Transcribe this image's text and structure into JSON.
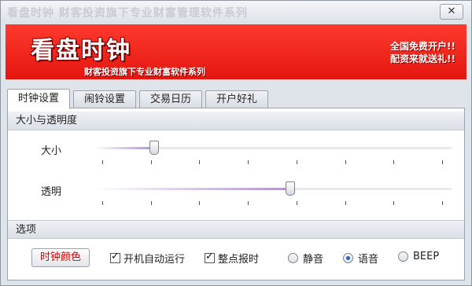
{
  "window": {
    "title": "看盘时钟 财客投资旗下专业财富管理软件系列",
    "close_icon": "close-x"
  },
  "banner": {
    "brand": "看盘时钟",
    "slogan": "财客投资旗下专业财富软件系列",
    "promo_line1": "全国免费开户!!",
    "promo_line2": "配资来就送礼!!"
  },
  "tabs": [
    {
      "label": "时钟设置",
      "active": true
    },
    {
      "label": "闹铃设置",
      "active": false
    },
    {
      "label": "交易日历",
      "active": false
    },
    {
      "label": "开户好礼",
      "active": false
    }
  ],
  "size_group": {
    "title": "大小与透明度",
    "size_label": "大小",
    "size_level": 0.17,
    "opacity_label": "透明",
    "opacity_level": 0.55,
    "tick_count": 8
  },
  "options": {
    "title": "选项",
    "color_button": "时钟颜色",
    "autostart": {
      "label": "开机自动运行",
      "checked": true
    },
    "hourly": {
      "label": "整点报时",
      "checked": true
    },
    "sound": {
      "options": [
        {
          "label": "静音",
          "selected": false
        },
        {
          "label": "语音",
          "selected": true
        },
        {
          "label": "BEEP",
          "selected": false
        }
      ]
    }
  }
}
